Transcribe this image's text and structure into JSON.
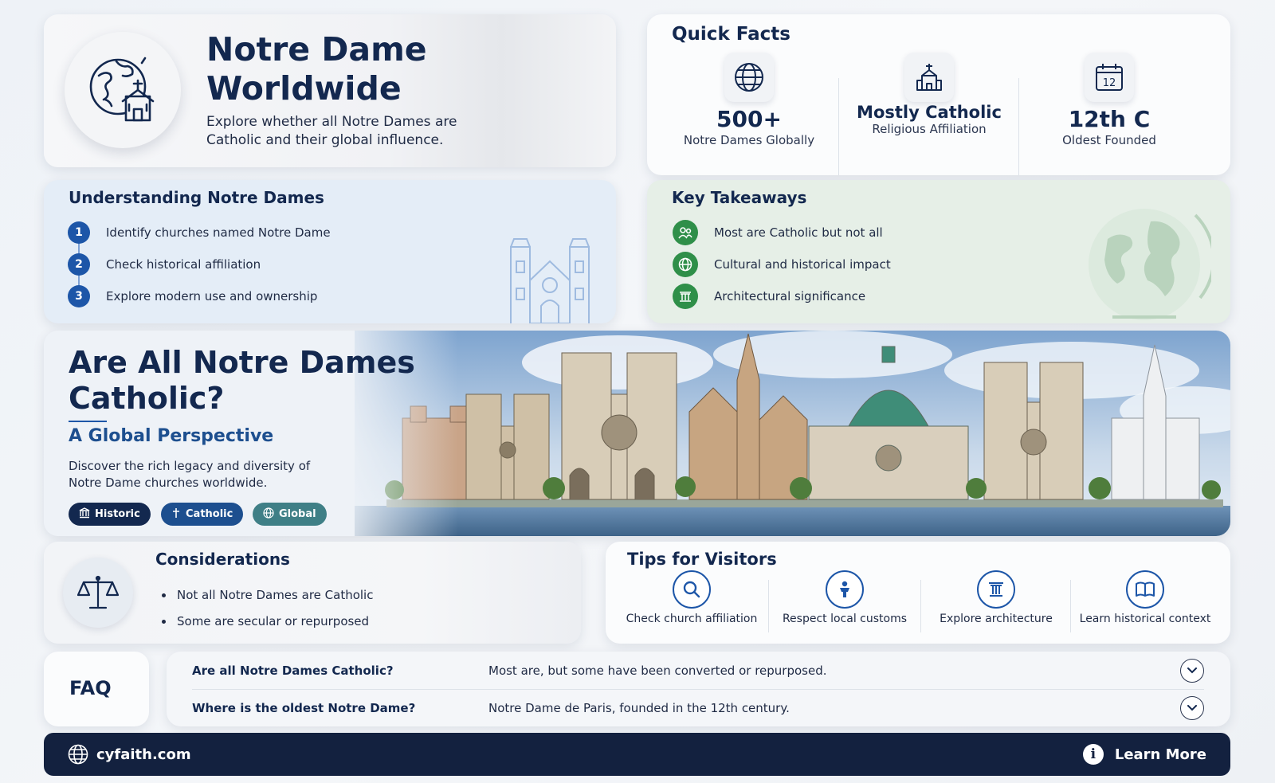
{
  "header": {
    "title": "Notre Dame Worldwide",
    "subtitle": "Explore whether all Notre Dames are Catholic and their global influence.",
    "icon": "globe-church-icon"
  },
  "quick_facts": {
    "title": "Quick Facts",
    "items": [
      {
        "icon": "globe-icon",
        "value": "500+",
        "label": "Notre Dames Globally"
      },
      {
        "icon": "church-icon",
        "value": "Mostly Catholic",
        "label": "Religious Affiliation"
      },
      {
        "icon": "calendar-icon",
        "calendar_day": "12",
        "value": "12th C",
        "label": "Oldest Founded"
      }
    ]
  },
  "understanding": {
    "title": "Understanding Notre Dames",
    "steps": [
      {
        "num": "1",
        "text": "Identify churches named Notre Dame"
      },
      {
        "num": "2",
        "text": "Check historical affiliation"
      },
      {
        "num": "3",
        "text": "Explore modern use and ownership"
      }
    ]
  },
  "takeaways": {
    "title": "Key Takeaways",
    "items": [
      {
        "icon": "people-icon",
        "text": "Most are Catholic but not all"
      },
      {
        "icon": "globe-icon",
        "text": "Cultural and historical impact"
      },
      {
        "icon": "pillar-icon",
        "text": "Architectural significance"
      }
    ]
  },
  "banner": {
    "title": "Are All Notre Dames Catholic?",
    "subtitle": "A Global Perspective",
    "description": "Discover the rich legacy and diversity of Notre Dame churches worldwide.",
    "tags": [
      {
        "icon": "museum-icon",
        "label": "Historic",
        "color": "#13284f"
      },
      {
        "icon": "cross-icon",
        "label": "Catholic",
        "color": "#1d4f8f"
      },
      {
        "icon": "globe-icon",
        "label": "Global",
        "color": "#3f7f86"
      }
    ]
  },
  "considerations": {
    "title": "Considerations",
    "icon": "scale-icon",
    "items": [
      "Not all Notre Dames are Catholic",
      "Some are secular or repurposed"
    ]
  },
  "tips": {
    "title": "Tips for Visitors",
    "items": [
      {
        "icon": "search-icon",
        "label": "Check church affiliation"
      },
      {
        "icon": "person-icon",
        "label": "Respect local customs"
      },
      {
        "icon": "pillar-icon",
        "label": "Explore architecture"
      },
      {
        "icon": "book-icon",
        "label": "Learn historical context"
      }
    ]
  },
  "faq": {
    "title": "FAQ",
    "items": [
      {
        "q": "Are all Notre Dames Catholic?",
        "a": "Most are, but some have been converted or repurposed."
      },
      {
        "q": "Where is the oldest Notre Dame?",
        "a": "Notre Dame de Paris, founded in the 12th century."
      }
    ]
  },
  "footer": {
    "site": "cyfaith.com",
    "cta": "Learn More"
  },
  "colors": {
    "navy": "#13284f",
    "accent_blue": "#1d56a8",
    "green": "#2f8f49",
    "footer_bg": "#13213f"
  }
}
